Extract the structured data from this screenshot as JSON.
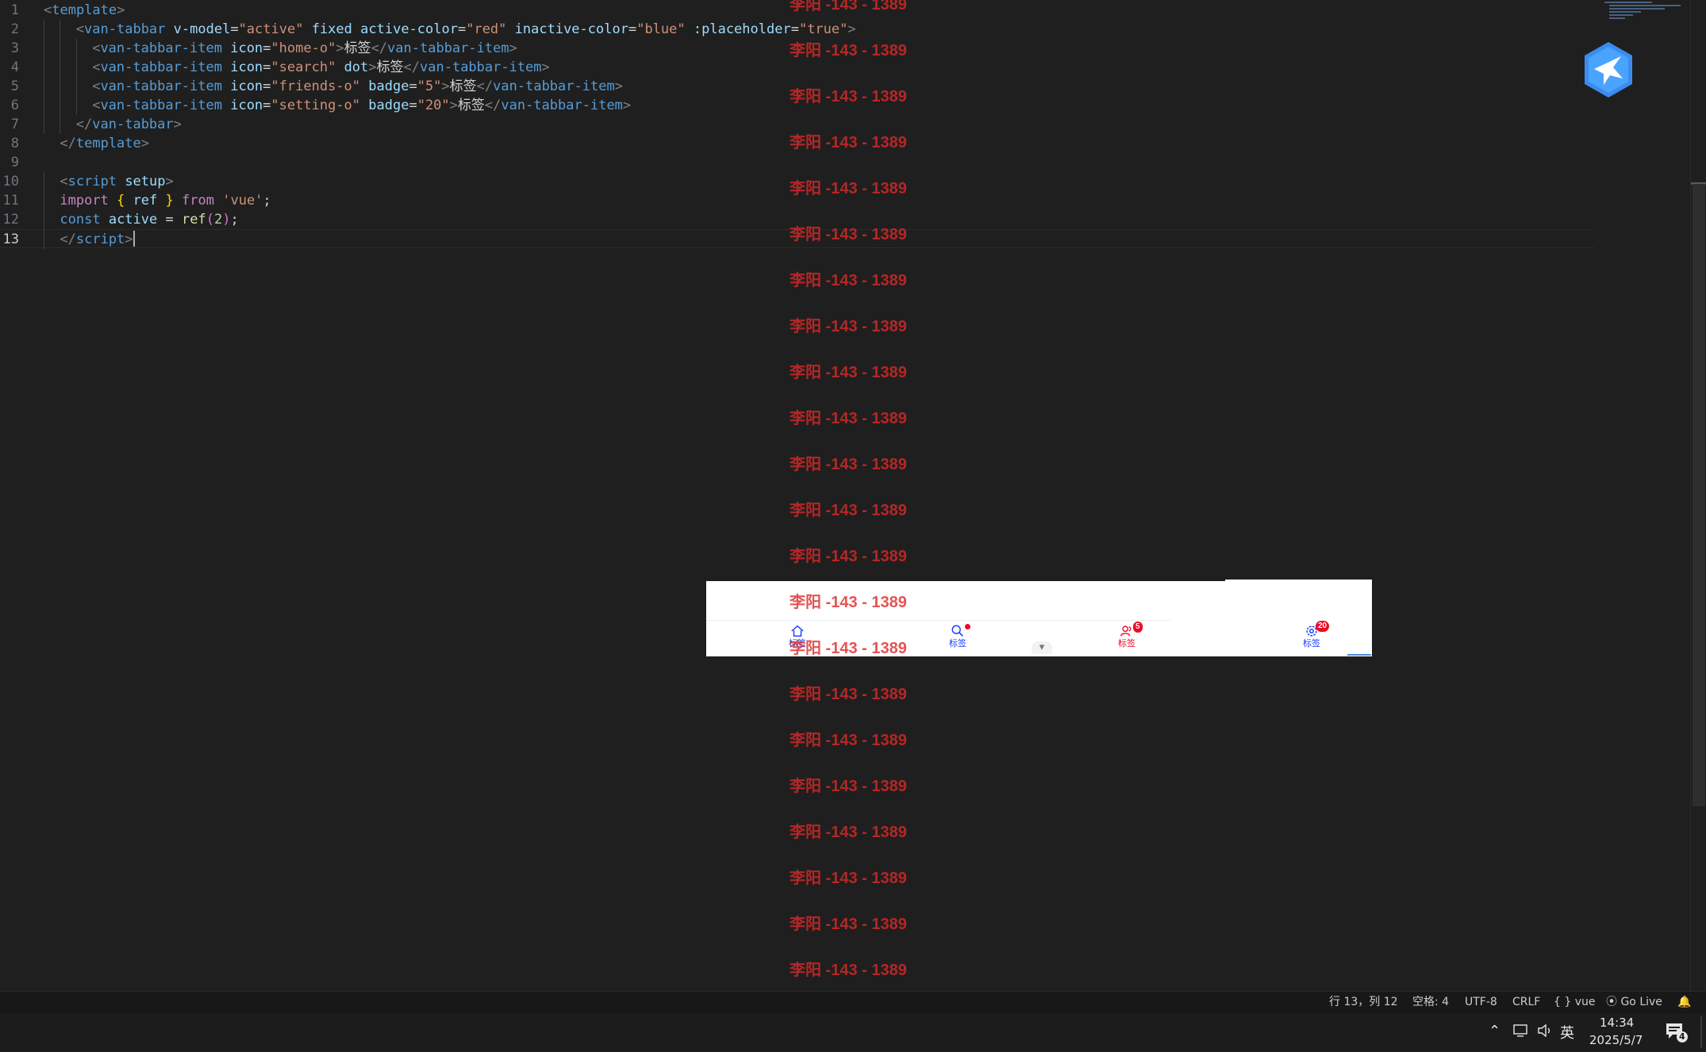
{
  "editor": {
    "lines": [
      {
        "num": "1",
        "tokens": [
          [
            "t-br",
            "<"
          ],
          [
            "t-tag",
            "template"
          ],
          [
            "t-br",
            ">"
          ]
        ]
      },
      {
        "num": "2",
        "tokens": [
          [
            "t-br",
            "<"
          ],
          [
            "t-tag",
            "van-tabbar"
          ],
          [
            "t-op",
            " "
          ],
          [
            "t-attr",
            "v-model"
          ],
          [
            "t-op",
            "="
          ],
          [
            "t-str",
            "\"active\""
          ],
          [
            "t-op",
            " "
          ],
          [
            "t-attr",
            "fixed"
          ],
          [
            "t-op",
            " "
          ],
          [
            "t-attr",
            "active-color"
          ],
          [
            "t-op",
            "="
          ],
          [
            "t-str",
            "\"red\""
          ],
          [
            "t-op",
            " "
          ],
          [
            "t-attr",
            "inactive-color"
          ],
          [
            "t-op",
            "="
          ],
          [
            "t-str",
            "\"blue\""
          ],
          [
            "t-op",
            " "
          ],
          [
            "t-attr",
            ":placeholder"
          ],
          [
            "t-op",
            "="
          ],
          [
            "t-str",
            "\"true\""
          ],
          [
            "t-br",
            ">"
          ]
        ]
      },
      {
        "num": "3",
        "tokens": [
          [
            "t-br",
            "<"
          ],
          [
            "t-tag",
            "van-tabbar-item"
          ],
          [
            "t-op",
            " "
          ],
          [
            "t-attr",
            "icon"
          ],
          [
            "t-op",
            "="
          ],
          [
            "t-str",
            "\"home-o\""
          ],
          [
            "t-br",
            ">"
          ],
          [
            "t-txt",
            "标签"
          ],
          [
            "t-br",
            "</"
          ],
          [
            "t-tag",
            "van-tabbar-item"
          ],
          [
            "t-br",
            ">"
          ]
        ]
      },
      {
        "num": "4",
        "tokens": [
          [
            "t-br",
            "<"
          ],
          [
            "t-tag",
            "van-tabbar-item"
          ],
          [
            "t-op",
            " "
          ],
          [
            "t-attr",
            "icon"
          ],
          [
            "t-op",
            "="
          ],
          [
            "t-str",
            "\"search\""
          ],
          [
            "t-op",
            " "
          ],
          [
            "t-attr",
            "dot"
          ],
          [
            "t-br",
            ">"
          ],
          [
            "t-txt",
            "标签"
          ],
          [
            "t-br",
            "</"
          ],
          [
            "t-tag",
            "van-tabbar-item"
          ],
          [
            "t-br",
            ">"
          ]
        ]
      },
      {
        "num": "5",
        "tokens": [
          [
            "t-br",
            "<"
          ],
          [
            "t-tag",
            "van-tabbar-item"
          ],
          [
            "t-op",
            " "
          ],
          [
            "t-attr",
            "icon"
          ],
          [
            "t-op",
            "="
          ],
          [
            "t-str",
            "\"friends-o\""
          ],
          [
            "t-op",
            " "
          ],
          [
            "t-attr",
            "badge"
          ],
          [
            "t-op",
            "="
          ],
          [
            "t-str",
            "\"5\""
          ],
          [
            "t-br",
            ">"
          ],
          [
            "t-txt",
            "标签"
          ],
          [
            "t-br",
            "</"
          ],
          [
            "t-tag",
            "van-tabbar-item"
          ],
          [
            "t-br",
            ">"
          ]
        ]
      },
      {
        "num": "6",
        "tokens": [
          [
            "t-br",
            "<"
          ],
          [
            "t-tag",
            "van-tabbar-item"
          ],
          [
            "t-op",
            " "
          ],
          [
            "t-attr",
            "icon"
          ],
          [
            "t-op",
            "="
          ],
          [
            "t-str",
            "\"setting-o\""
          ],
          [
            "t-op",
            " "
          ],
          [
            "t-attr",
            "badge"
          ],
          [
            "t-op",
            "="
          ],
          [
            "t-str",
            "\"20\""
          ],
          [
            "t-br",
            ">"
          ],
          [
            "t-txt",
            "标签"
          ],
          [
            "t-br",
            "</"
          ],
          [
            "t-tag",
            "van-tabbar-item"
          ],
          [
            "t-br",
            ">"
          ]
        ]
      },
      {
        "num": "7",
        "tokens": [
          [
            "t-br",
            "</"
          ],
          [
            "t-tag",
            "van-tabbar"
          ],
          [
            "t-br",
            ">"
          ]
        ]
      },
      {
        "num": "8",
        "tokens": [
          [
            "t-br",
            "</"
          ],
          [
            "t-tag",
            "template"
          ],
          [
            "t-br",
            ">"
          ]
        ]
      },
      {
        "num": "9",
        "tokens": []
      },
      {
        "num": "10",
        "tokens": [
          [
            "t-br",
            "<"
          ],
          [
            "t-tag",
            "script"
          ],
          [
            "t-op",
            " "
          ],
          [
            "t-attr",
            "setup"
          ],
          [
            "t-br",
            ">"
          ]
        ]
      },
      {
        "num": "11",
        "tokens": [
          [
            "t-kw",
            "import"
          ],
          [
            "t-op",
            " "
          ],
          [
            "t-brc",
            "{"
          ],
          [
            "t-op",
            " "
          ],
          [
            "t-var",
            "ref"
          ],
          [
            "t-op",
            " "
          ],
          [
            "t-brc",
            "}"
          ],
          [
            "t-op",
            " "
          ],
          [
            "t-kw",
            "from"
          ],
          [
            "t-op",
            " "
          ],
          [
            "t-str",
            "'vue'"
          ],
          [
            "t-op",
            ";"
          ]
        ]
      },
      {
        "num": "12",
        "tokens": [
          [
            "t-dec",
            "const"
          ],
          [
            "t-op",
            " "
          ],
          [
            "t-var",
            "active"
          ],
          [
            "t-op",
            " = "
          ],
          [
            "t-fn",
            "ref"
          ],
          [
            "t-brp",
            "("
          ],
          [
            "t-num",
            "2"
          ],
          [
            "t-brp",
            ")"
          ],
          [
            "t-op",
            ";"
          ]
        ]
      },
      {
        "num": "13",
        "tokens": [
          [
            "t-br",
            "</"
          ],
          [
            "t-tag",
            "script"
          ],
          [
            "t-br",
            ">"
          ]
        ]
      }
    ]
  },
  "preview": {
    "tabs": [
      {
        "label": "标签",
        "icon": "home-o-icon",
        "state": "inactive"
      },
      {
        "label": "标签",
        "icon": "search-icon",
        "state": "inactive",
        "dot": true
      },
      {
        "label": "标签",
        "icon": "friends-o-icon",
        "state": "active",
        "badge": "5"
      },
      {
        "label": "标签",
        "icon": "setting-o-icon",
        "state": "inactive",
        "badge": "20"
      }
    ],
    "handle_glyph": "▾"
  },
  "watermark": {
    "text": "李阳 -143 - 1389"
  },
  "statusbar": {
    "position": "行 13，列 12",
    "spaces": "空格: 4",
    "encoding": "UTF-8",
    "eol": "CRLF",
    "language": "vue",
    "go_live": "Go Live"
  },
  "taskbar": {
    "ime": "英",
    "time": "14:34",
    "date": "2025/5/7",
    "notifications": "4"
  },
  "colors": {
    "active": "#ee0a24",
    "inactive": "#1a3cff",
    "editor_bg": "#1f1f1f"
  }
}
